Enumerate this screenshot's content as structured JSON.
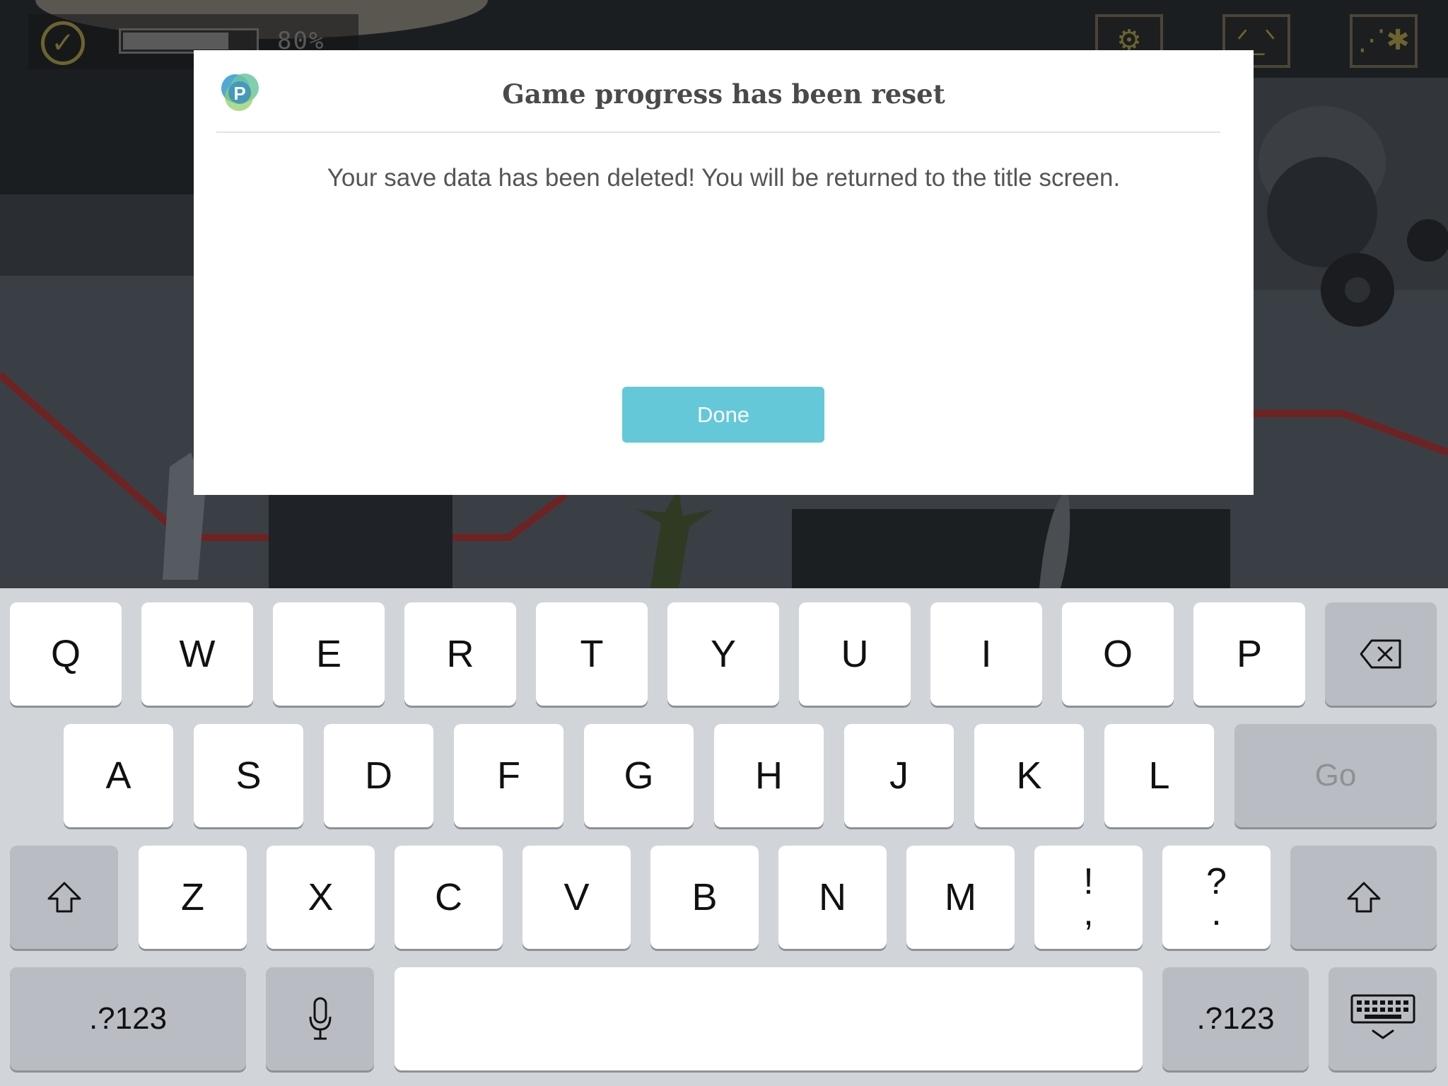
{
  "hud": {
    "progress_text": "80%",
    "progress_value": 0.8,
    "icons": [
      "check-badge-icon",
      "gear-icon",
      "face-icon",
      "map-icon"
    ]
  },
  "dialog": {
    "logo_letter": "P",
    "title": "Game progress has been reset",
    "message": "Your save data has been deleted! You will be returned to the title screen.",
    "done_label": "Done",
    "accent_color": "#64c8d9"
  },
  "keyboard": {
    "row1": [
      "Q",
      "W",
      "E",
      "R",
      "T",
      "Y",
      "U",
      "I",
      "O",
      "P"
    ],
    "row2": [
      "A",
      "S",
      "D",
      "F",
      "G",
      "H",
      "J",
      "K",
      "L"
    ],
    "go_label": "Go",
    "row3": [
      "Z",
      "X",
      "C",
      "V",
      "B",
      "N",
      "M"
    ],
    "exclaim_top": "!",
    "exclaim_bottom": ",",
    "question_top": "?",
    "question_bottom": ".",
    "numbers_label": ".?123",
    "numbers_label_right": ".?123",
    "icons": [
      "backspace-icon",
      "shift-icon",
      "microphone-icon",
      "hide-keyboard-icon"
    ]
  }
}
